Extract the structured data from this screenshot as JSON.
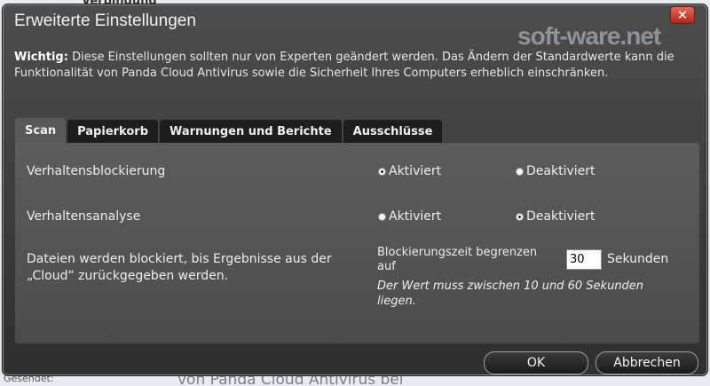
{
  "background": {
    "top_text": "Verbindung",
    "bottom_left_text": "Gesendet:",
    "bottom_mid_text": "von Panda Cloud Antivirus bei"
  },
  "dialog": {
    "title": "Erweiterte Einstellungen",
    "close_symbol": "✕",
    "watermark": "soft-ware.net",
    "warning_bold": "Wichtig:",
    "warning_text": " Diese Einstellungen sollten nur von Experten geändert werden. Das Ändern der Standardwerte kann die Funktionalität von Panda Cloud Antivirus sowie die Sicherheit Ihres Computers erheblich einschränken."
  },
  "tabs": [
    {
      "label": "Scan",
      "active": true
    },
    {
      "label": "Papierkorb",
      "active": false
    },
    {
      "label": "Warnungen und Berichte",
      "active": false
    },
    {
      "label": "Ausschlüsse",
      "active": false
    }
  ],
  "settings": {
    "behavior_blocking": {
      "label": "Verhaltensblockierung",
      "option_on": "Aktiviert",
      "option_off": "Deaktiviert",
      "selected": "Aktiviert"
    },
    "behavior_analysis": {
      "label": "Verhaltensanalyse",
      "option_on": "Aktiviert",
      "option_off": "Deaktiviert",
      "selected": "Deaktiviert"
    },
    "blocking": {
      "label": "Dateien werden blockiert, bis Ergebnisse aus der „Cloud“ zurückgegeben werden.",
      "limit_label": "Blockierungszeit begrenzen auf",
      "value": "30",
      "unit": "Sekunden",
      "hint": "Der Wert muss zwischen 10 und 60 Sekunden liegen."
    }
  },
  "buttons": {
    "ok": "OK",
    "cancel": "Abbrechen"
  },
  "colors": {
    "close_button": "#c8321f",
    "dialog_bg": "#3f3f3f",
    "panel_bg": "#555555"
  }
}
